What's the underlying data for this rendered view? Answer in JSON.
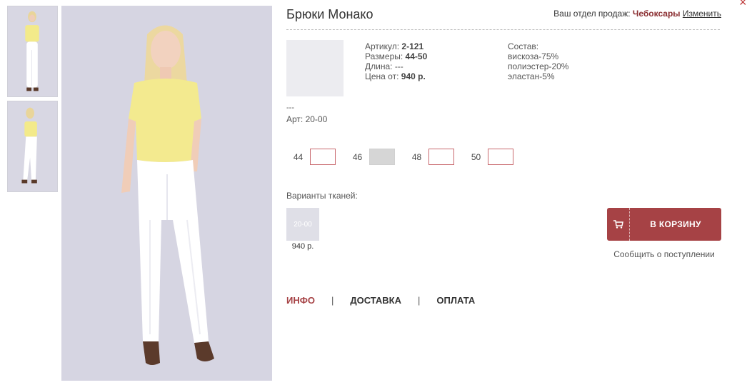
{
  "product": {
    "title": "Брюки Монако",
    "article_label": "Артикул:",
    "article_value": "2-121",
    "sizes_label": "Размеры:",
    "sizes_value": "44-50",
    "length_label": "Длина:",
    "length_value": "---",
    "price_label": "Цена от:",
    "price_value": "940 р.",
    "dashes": "---",
    "art_line": "Арт: 20-00"
  },
  "composition": {
    "label": "Состав:",
    "items": [
      "вискоза-75%",
      "полиэстер-20%",
      "эластан-5%"
    ]
  },
  "sales": {
    "label": "Ваш отдел продаж:",
    "city": "Чебоксары",
    "change": "Изменить"
  },
  "size_options": [
    {
      "label": "44",
      "available": true
    },
    {
      "label": "46",
      "available": false
    },
    {
      "label": "48",
      "available": true
    },
    {
      "label": "50",
      "available": true
    }
  ],
  "variants": {
    "label": "Варианты тканей:",
    "tile_label": "20-00",
    "tile_price": "940 р."
  },
  "cart": {
    "button_label": "В КОРЗИНУ",
    "notify_label": "Сообщить о поступлении"
  },
  "tabs": [
    {
      "label": "ИНФО",
      "active": true
    },
    {
      "label": "ДОСТАВКА",
      "active": false
    },
    {
      "label": "ОПЛАТА",
      "active": false
    }
  ],
  "colors": {
    "accent": "#a64245",
    "city": "#8b2f32",
    "size_border": "#c96a6f"
  },
  "icons": {
    "close": "close-icon",
    "cart": "cart-icon"
  }
}
